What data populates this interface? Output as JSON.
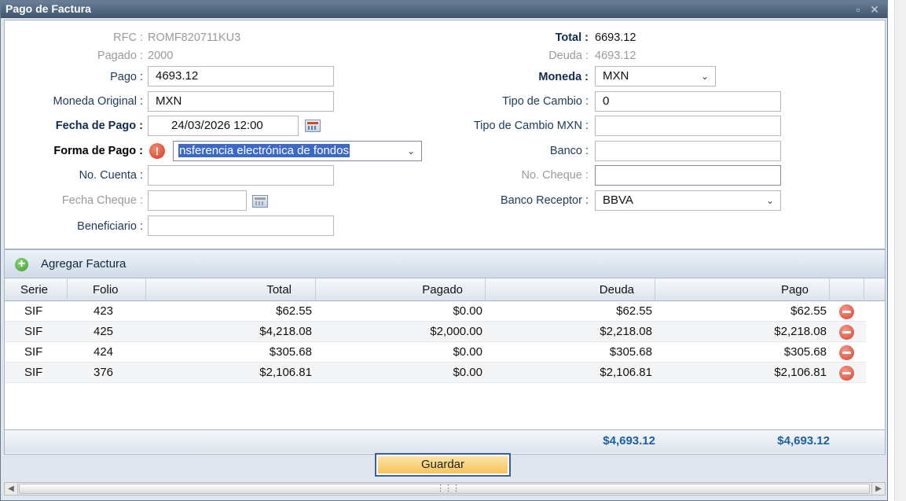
{
  "window": {
    "title": "Pago de Factura",
    "controls": {
      "maximize_icon": "maximize-icon",
      "close_icon": "close-icon"
    }
  },
  "form": {
    "rfc_label": "RFC :",
    "rfc_value": "ROMF820711KU3",
    "pagado_label": "Pagado :",
    "pagado_value": "2000",
    "total_label": "Total :",
    "total_value": "6693.12",
    "deuda_label": "Deuda :",
    "deuda_value": "4693.12",
    "pago_label": "Pago :",
    "pago_value": "4693.12",
    "moneda_label": "Moneda :",
    "moneda_value": "MXN",
    "moneda_original_label": "Moneda Original :",
    "moneda_original_value": "MXN",
    "tipo_cambio_label": "Tipo de Cambio :",
    "tipo_cambio_value": "0",
    "fecha_pago_label": "Fecha de Pago :",
    "fecha_pago_value": "24/03/2026 12:00",
    "tipo_cambio_mxn_label": "Tipo de Cambio MXN :",
    "tipo_cambio_mxn_value": "",
    "forma_pago_label": "Forma de Pago :",
    "forma_pago_value": "nsferencia electrónica de fondos",
    "banco_label": "Banco :",
    "banco_value": "",
    "no_cuenta_label": "No. Cuenta :",
    "no_cuenta_value": "",
    "no_cheque_label": "No. Cheque :",
    "no_cheque_value": "",
    "fecha_cheque_label": "Fecha Cheque :",
    "fecha_cheque_value": "",
    "banco_receptor_label": "Banco Receptor :",
    "banco_receptor_value": "BBVA",
    "beneficiario_label": "Beneficiario :",
    "beneficiario_value": "",
    "warning_glyph": "!"
  },
  "grid": {
    "add_label": "Agregar Factura",
    "columns": [
      "Serie",
      "Folio",
      "Total",
      "Pagado",
      "Deuda",
      "Pago"
    ],
    "rows": [
      {
        "serie": "SIF",
        "folio": "423",
        "total": "$62.55",
        "pagado": "$0.00",
        "deuda": "$62.55",
        "pago": "$62.55"
      },
      {
        "serie": "SIF",
        "folio": "425",
        "total": "$4,218.08",
        "pagado": "$2,000.00",
        "deuda": "$2,218.08",
        "pago": "$2,218.08"
      },
      {
        "serie": "SIF",
        "folio": "424",
        "total": "$305.68",
        "pagado": "$0.00",
        "deuda": "$305.68",
        "pago": "$305.68"
      },
      {
        "serie": "SIF",
        "folio": "376",
        "total": "$2,106.81",
        "pagado": "$0.00",
        "deuda": "$2,106.81",
        "pago": "$2,106.81"
      }
    ],
    "summary": {
      "deuda": "$4,693.12",
      "pago": "$4,693.12"
    }
  },
  "actions": {
    "save_label": "Guardar"
  },
  "colors": {
    "titlebar": "#3f536b",
    "accent_blue": "#1b5fa6",
    "save_button": "#f6c45c",
    "selection": "#3c68c8"
  }
}
